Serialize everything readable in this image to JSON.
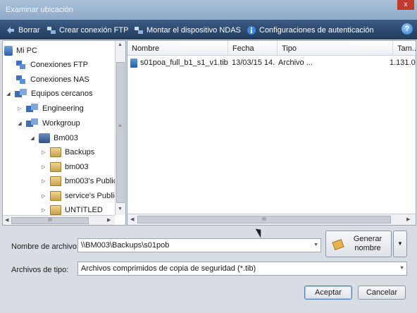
{
  "window": {
    "title": "Examinar ubicación",
    "close_glyph": "x"
  },
  "toolbar": {
    "items": [
      {
        "label": "Borrar",
        "icon": "back-arrow-icon"
      },
      {
        "label": "Crear conexión FTP",
        "icon": "network-icon"
      },
      {
        "label": "Montar el dispositivo NDAS",
        "icon": "network-icon"
      },
      {
        "label": "Configuraciones de autenticación",
        "icon": "info-icon"
      }
    ],
    "help": "?"
  },
  "tree": {
    "items": [
      {
        "label": "Mi PC",
        "expander": "",
        "icon": "computer-icon"
      },
      {
        "label": "Conexiones FTP",
        "expander": "",
        "icon": "network-icon"
      },
      {
        "label": "Conexiones NAS",
        "expander": "",
        "icon": "network-icon"
      },
      {
        "label": "Equipos cercanos",
        "expander": "◢",
        "icon": "workgroup-icon"
      },
      {
        "label": "Engineering",
        "expander": "▷",
        "icon": "workgroup-icon"
      },
      {
        "label": "Workgroup",
        "expander": "◢",
        "icon": "workgroup-icon"
      },
      {
        "label": "Bm003",
        "expander": "◢",
        "icon": "server-icon"
      },
      {
        "label": "Backups",
        "expander": "▷",
        "icon": "share-icon"
      },
      {
        "label": "bm003",
        "expander": "▷",
        "icon": "share-icon"
      },
      {
        "label": "bm003's Public",
        "expander": "▷",
        "icon": "share-icon"
      },
      {
        "label": "service's Public",
        "expander": "▷",
        "icon": "share-icon"
      },
      {
        "label": "UNTITLED",
        "expander": "▷",
        "icon": "share-icon"
      }
    ],
    "grip": "≡",
    "hgrip": "III"
  },
  "files": {
    "columns": [
      "Nombre",
      "Fecha",
      "Tipo",
      "Tam..."
    ],
    "rows": [
      {
        "name": "s01poa_full_b1_s1_v1.tib",
        "date": "13/03/15 14...",
        "type": "Archivo ...",
        "size": "1.131.0"
      }
    ],
    "hgrip": "III"
  },
  "form": {
    "filename_label": "Nombre de archivo:",
    "filename_value": "\\\\BM003\\Backups\\s01pob",
    "generate_label": "Generar nombre",
    "filetype_label": "Archivos de tipo:",
    "filetype_value": "Archivos comprimidos de copia de seguridad (*.tib)",
    "accept_label": "Aceptar",
    "cancel_label": "Cancelar"
  }
}
